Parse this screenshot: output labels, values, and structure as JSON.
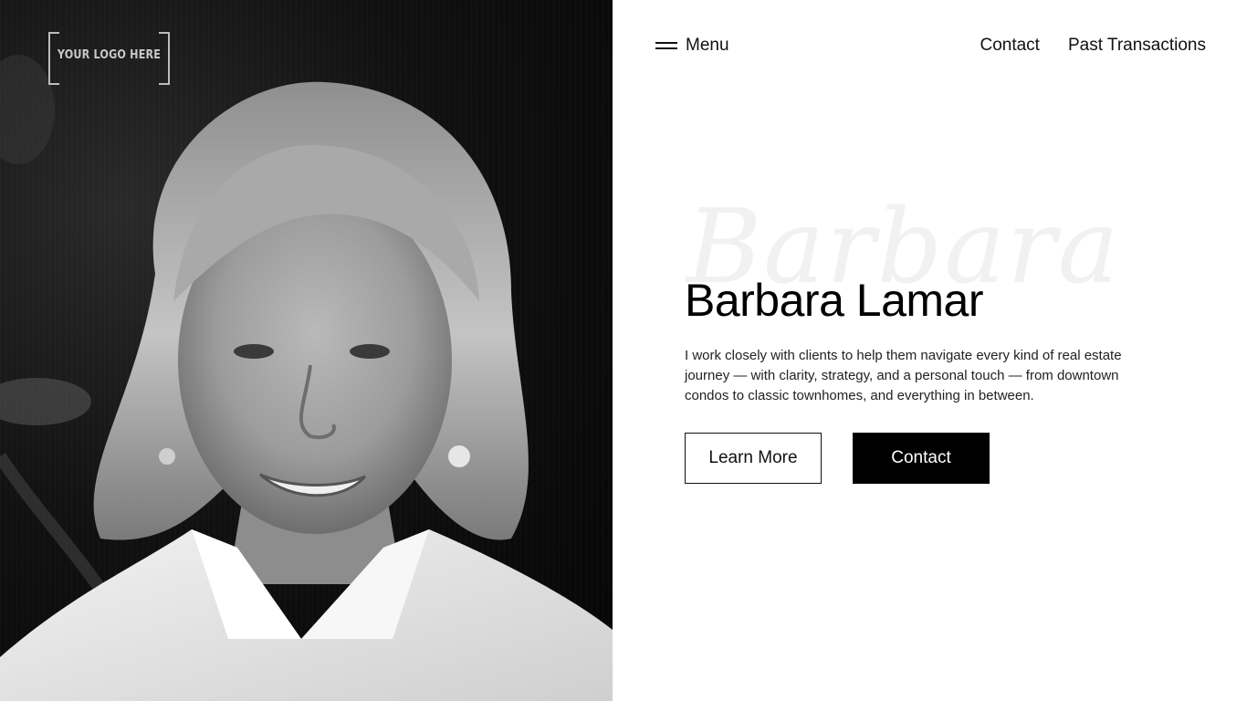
{
  "logo": {
    "text": "YOUR LOGO HERE"
  },
  "header": {
    "menu_label": "Menu",
    "links": [
      "Contact",
      "Past Transactions"
    ]
  },
  "hero": {
    "script_text": "Barbara",
    "title": "Barbara Lamar",
    "description": "I work closely with clients to help them navigate every kind of real estate journey — with clarity, strategy, and a personal touch — from downtown condos to classic townhomes, and everything in between.",
    "buttons": {
      "primary": "Learn More",
      "secondary": "Contact"
    }
  },
  "colors": {
    "text": "#000000",
    "button_solid_bg": "#000000",
    "background": "#ffffff"
  }
}
